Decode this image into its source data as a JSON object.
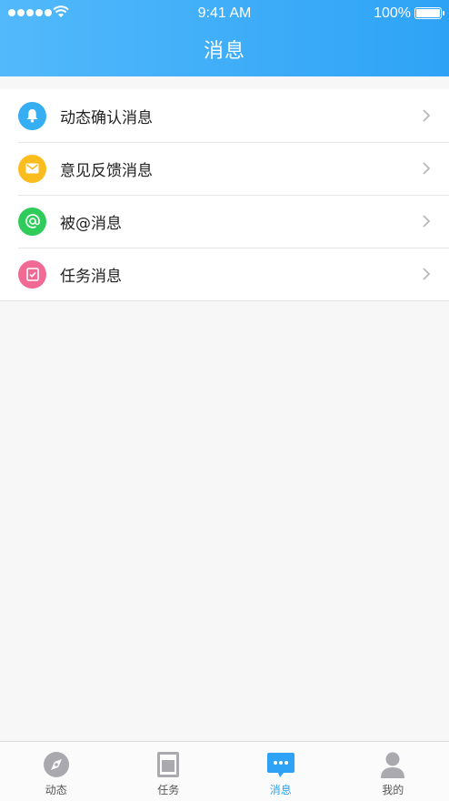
{
  "status_bar": {
    "time": "9:41 AM",
    "battery": "100%"
  },
  "header": {
    "title": "消息"
  },
  "messages": [
    {
      "label": "动态确认消息",
      "icon": "bell-icon",
      "color": "#36aef4"
    },
    {
      "label": "意见反馈消息",
      "icon": "mail-icon",
      "color": "#fbbd1d"
    },
    {
      "label": "被@消息",
      "icon": "at-icon",
      "color": "#2fcb5b"
    },
    {
      "label": "任务消息",
      "icon": "task-icon",
      "color": "#f06a94"
    }
  ],
  "tabbar": {
    "tabs": [
      {
        "label": "动态",
        "icon": "compass-icon",
        "active": false
      },
      {
        "label": "任务",
        "icon": "document-icon",
        "active": false
      },
      {
        "label": "消息",
        "icon": "chat-icon",
        "active": true
      },
      {
        "label": "我的",
        "icon": "person-icon",
        "active": false
      }
    ]
  },
  "colors": {
    "accent": "#2ea3f6",
    "header_start": "#52b9fb",
    "header_end": "#2ea3f6"
  }
}
